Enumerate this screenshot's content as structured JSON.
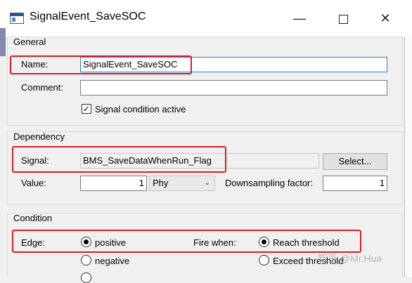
{
  "window": {
    "title": "SignalEvent_SaveSOC",
    "min_glyph": "—",
    "close_glyph": "✕"
  },
  "general": {
    "group_title": "General",
    "name_label": "Name:",
    "name_value": "SignalEvent_SaveSOC",
    "comment_label": "Comment:",
    "comment_value": "",
    "active_label": "Signal condition active",
    "active_checked": true
  },
  "dependency": {
    "group_title": "Dependency",
    "signal_label": "Signal:",
    "signal_value": "BMS_SaveDataWhenRun_Flag",
    "select_button": "Select...",
    "value_label": "Value:",
    "value_value": "1",
    "unit_option": "Phy",
    "downsampling_label": "Downsampling factor:",
    "downsampling_value": "1"
  },
  "condition": {
    "group_title": "Condition",
    "edge_label": "Edge:",
    "edge_options": [
      "positive",
      "negative"
    ],
    "edge_selected": "positive",
    "fire_label": "Fire when:",
    "fire_options": [
      "Reach threshold",
      "Exceed threshold"
    ],
    "fire_selected": "Reach threshold"
  },
  "watermark": "知乎 @Mr.Hua",
  "colors": {
    "highlight": "#d0202a",
    "focus_border": "#2d7bd5"
  }
}
